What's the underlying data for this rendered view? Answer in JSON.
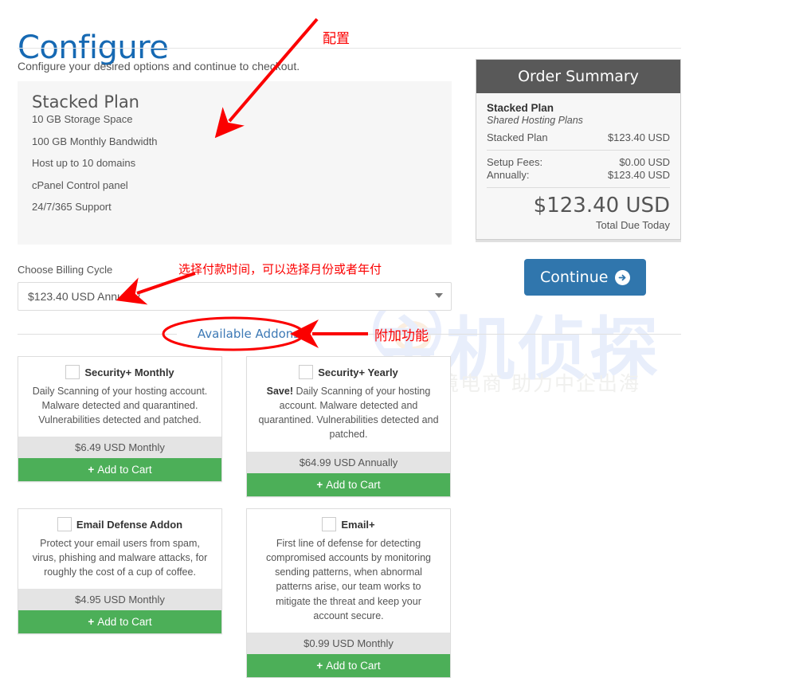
{
  "header": {
    "title": "Configure",
    "subtitle": "Configure your desired options and continue to checkout."
  },
  "plan": {
    "name": "Stacked Plan",
    "features": [
      "10 GB Storage Space",
      "100 GB Monthly Bandwidth",
      "Host up to 10 domains",
      "cPanel Control panel",
      "24/7/365 Support"
    ]
  },
  "billing": {
    "label": "Choose Billing Cycle",
    "selected": "$123.40 USD Annually",
    "options": [
      "$123.40 USD Annually"
    ]
  },
  "addons_divider": {
    "label": "Available Addons"
  },
  "addons": [
    {
      "title": "Security+ Monthly",
      "desc_bold": "",
      "desc": "Daily Scanning of your hosting account. Malware detected and quarantined. Vulnerabilities detected and patched.",
      "price": "$6.49 USD Monthly",
      "cart_label": "Add to Cart",
      "checked": false
    },
    {
      "title": "Security+ Yearly",
      "desc_bold": "Save!",
      "desc": "Daily Scanning of your hosting account. Malware detected and quarantined. Vulnerabilities detected and patched.",
      "price": "$64.99 USD Annually",
      "cart_label": "Add to Cart",
      "checked": false
    },
    {
      "title": "Email Defense Addon",
      "desc_bold": "",
      "desc": "Protect your email users from spam, virus, phishing and malware attacks, for roughly the cost of a cup of coffee.",
      "price": "$4.95 USD Monthly",
      "cart_label": "Add to Cart",
      "checked": false
    },
    {
      "title": "Email+",
      "desc_bold": "",
      "desc": "First line of defense for detecting compromised accounts by monitoring sending patterns, when abnormal patterns arise, our team works to mitigate the threat and keep your account secure.",
      "price": "$0.99 USD Monthly",
      "cart_label": "Add to Cart",
      "checked": false
    }
  ],
  "summary": {
    "heading": "Order Summary",
    "product": "Stacked Plan",
    "group": "Shared Hosting Plans",
    "line_item_label": "Stacked Plan",
    "line_item_value": "$123.40 USD",
    "setup_label": "Setup Fees:",
    "setup_value": "$0.00 USD",
    "recurring_label": "Annually:",
    "recurring_value": "$123.40 USD",
    "total": "$123.40 USD",
    "total_label": "Total Due Today"
  },
  "continue": {
    "label": "Continue",
    "icon": "arrow-right-circle-icon"
  },
  "annotations": [
    {
      "id": "anno-configure",
      "text": "配置"
    },
    {
      "id": "anno-billing",
      "text": "选择付款时间，可以选择月份或者年付"
    },
    {
      "id": "anno-addons",
      "text": "附加功能"
    }
  ],
  "watermark": {
    "main": "主机侦探",
    "sub": "服务跨境电商  助力中企出海"
  },
  "colors": {
    "title_blue": "#1669b3",
    "summary_header": "#595959",
    "cart_green": "#4caf58",
    "continue_blue": "#3076ad",
    "annotation_red": "#fb0000"
  }
}
